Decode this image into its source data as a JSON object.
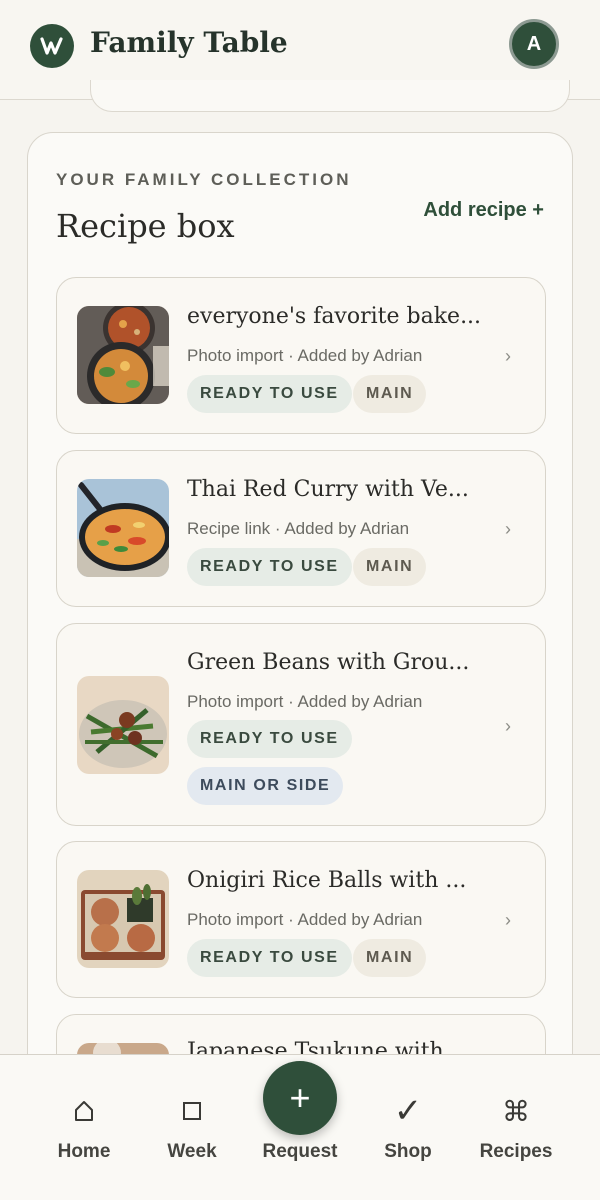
{
  "header": {
    "app_title": "Family Table",
    "logo_icon": "w-logo-icon",
    "avatar_initial": "A"
  },
  "collection": {
    "eyebrow": "YOUR FAMILY COLLECTION",
    "title": "Recipe box",
    "add_label": "Add recipe +"
  },
  "recipes": [
    {
      "title": "everyone's favorite bake...",
      "meta": "Photo import · Added by Adrian",
      "tags": [
        "READY TO USE",
        "MAIN"
      ]
    },
    {
      "title": "Thai Red Curry with Ve...",
      "meta": "Recipe link · Added by Adrian",
      "tags": [
        "READY TO USE",
        "MAIN"
      ]
    },
    {
      "title": "Green Beans with Grou...",
      "meta": "Photo import · Added by Adrian",
      "tags": [
        "READY TO USE",
        "MAIN OR SIDE"
      ]
    },
    {
      "title": "Onigiri Rice Balls with ...",
      "meta": "Photo import · Added by Adrian",
      "tags": [
        "READY TO USE",
        "MAIN"
      ]
    },
    {
      "title": "Japanese Tsukune with"
    }
  ],
  "nav": {
    "home": "Home",
    "week": "Week",
    "request": "Request",
    "shop": "Shop",
    "recipes": "Recipes",
    "fab_symbol": "+",
    "shop_symbol": "✓",
    "recipes_symbol": "⌘"
  },
  "colors": {
    "brand_green": "#2f4f3a",
    "background": "#f6f4ef",
    "ready_tag_bg": "#e6ece6",
    "main_tag_bg": "#efebe1",
    "side_tag_bg": "#e3e9f0"
  }
}
